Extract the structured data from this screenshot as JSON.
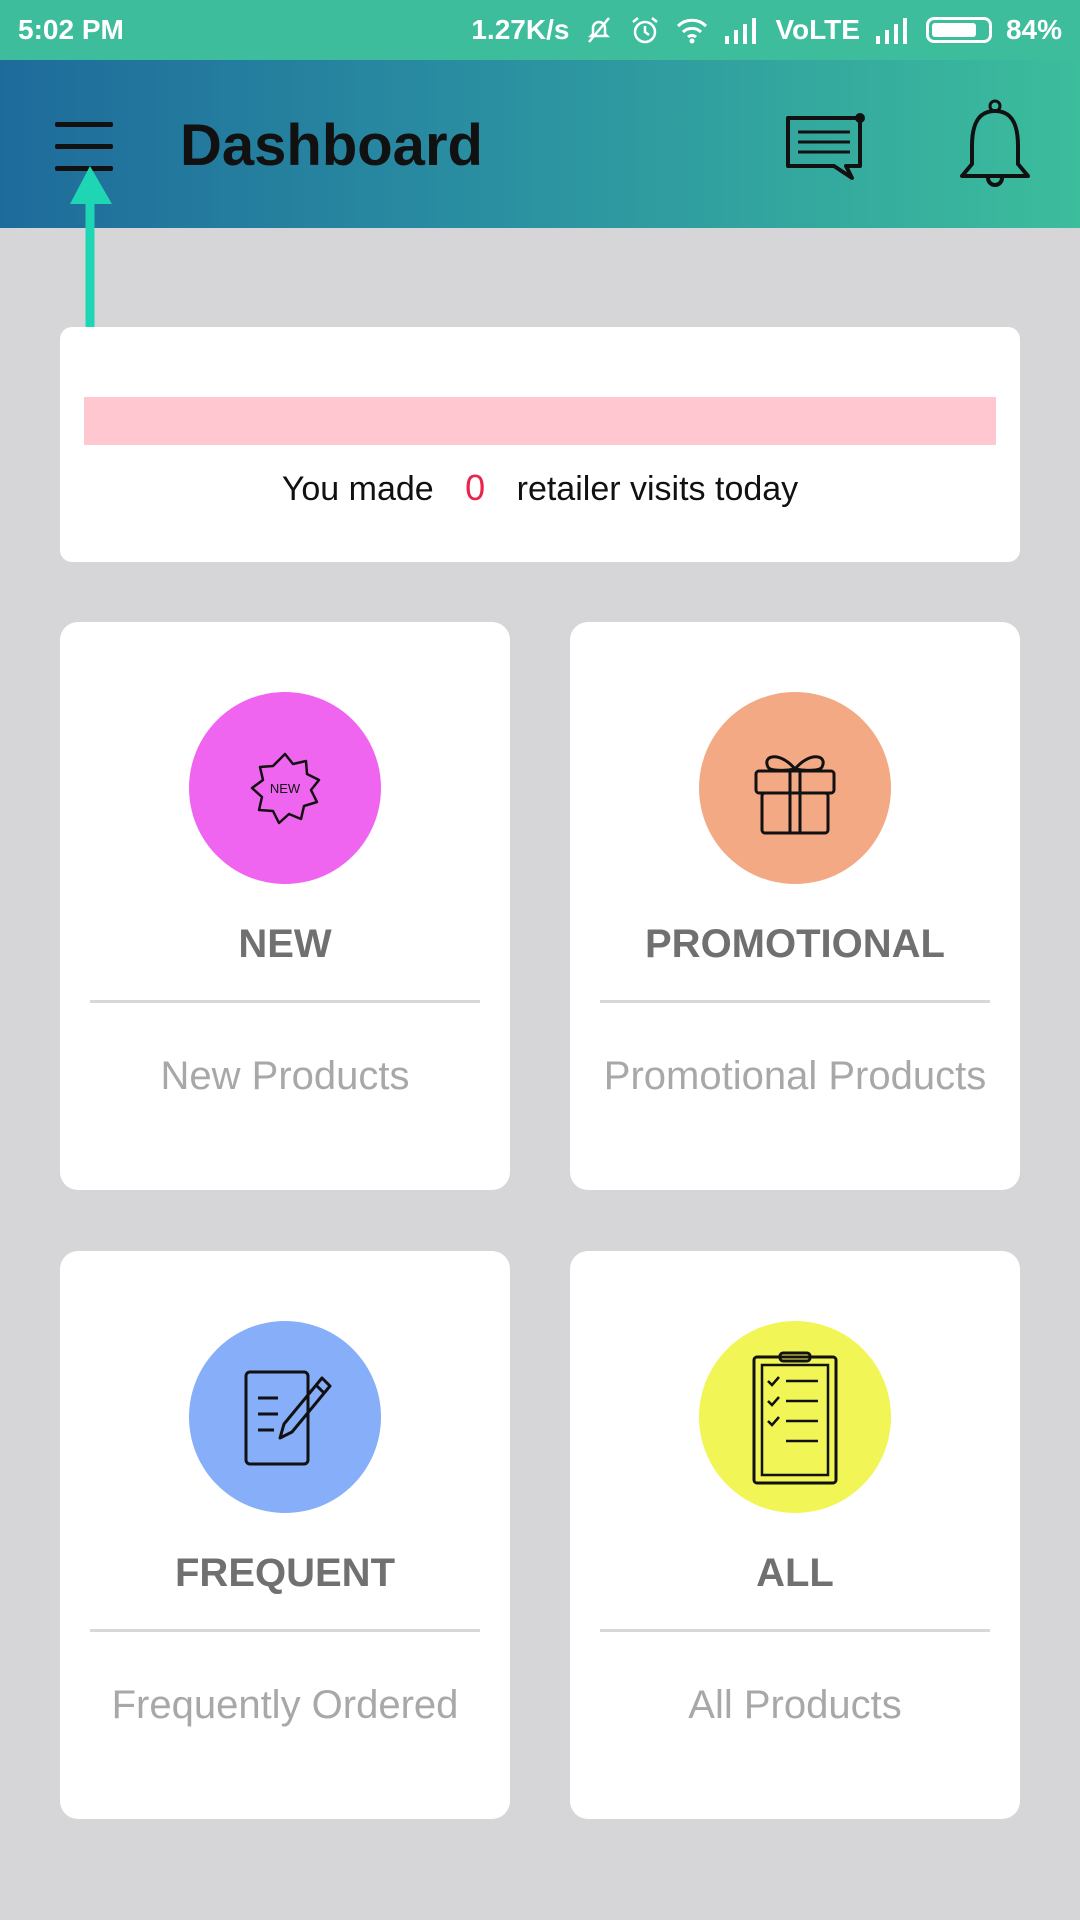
{
  "status_bar": {
    "time": "5:02 PM",
    "speed": "1.27K/s",
    "network": "VoLTE",
    "battery": "84%",
    "battery_level": 0.84
  },
  "app_bar": {
    "title": "Dashboard",
    "menu_icon": "hamburger-menu-icon",
    "chat_icon": "chat-icon",
    "bell_icon": "bell-icon"
  },
  "visits_card": {
    "prefix": "You made",
    "count": "0",
    "suffix": "retailer visits today",
    "count_color": "#e8254c",
    "bar_color": "#ffc8d1"
  },
  "tiles": [
    {
      "title": "NEW",
      "subtitle": "New Products",
      "icon": "new-badge-icon",
      "color": "#f065f0"
    },
    {
      "title": "PROMOTIONAL",
      "subtitle": "Promotional Products",
      "icon": "gift-icon",
      "color": "#f4a985"
    },
    {
      "title": "FREQUENT",
      "subtitle": "Frequently Ordered",
      "icon": "edit-document-icon",
      "color": "#87aef8"
    },
    {
      "title": "ALL",
      "subtitle": "All Products",
      "icon": "clipboard-checklist-icon",
      "color": "#f1f555"
    }
  ],
  "colors": {
    "status_bar": "#3dbd9c",
    "app_bar_start": "#1e6b9b",
    "app_bar_end": "#3cbd9c",
    "background": "#d6d6d8",
    "annotation_arrow": "#1fd6b4"
  }
}
